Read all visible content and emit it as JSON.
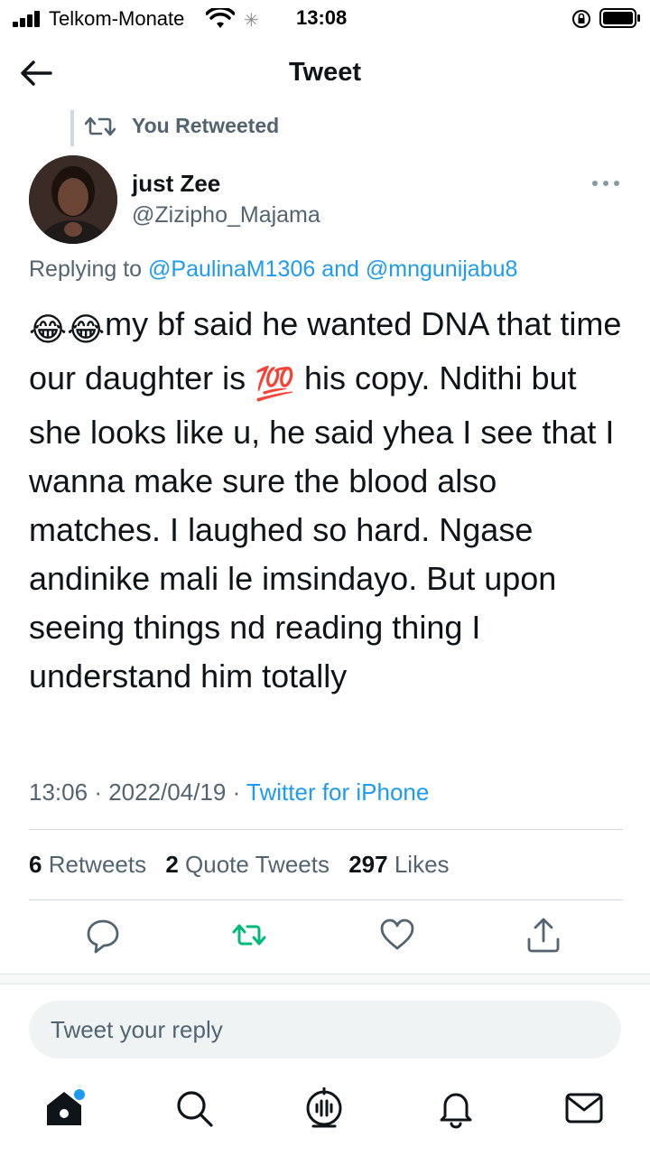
{
  "status_bar": {
    "carrier": "Telkom-Monate",
    "time": "13:08"
  },
  "header": {
    "title": "Tweet"
  },
  "retweet_context": {
    "label": "You Retweeted"
  },
  "author": {
    "name": "just Zee",
    "handle": "@Zizipho_Majama"
  },
  "replying": {
    "prefix": "Replying to",
    "mention_1": "@PaulinaM1306",
    "conjunction": "and",
    "mention_2": "@mngunijabu8"
  },
  "tweet": {
    "emojis_lead": "😂😂",
    "text_part1": "my bf said he wanted DNA that time our daughter is",
    "emoji_mid": "💯",
    "text_part2": "his copy. Ndithi but she looks like u, he said yhea I see that I wanna make sure the blood also matches. I laughed so hard. Ngase andinike mali le imsindayo. But upon seeing things nd reading thing I understand him totally",
    "time": "13:06",
    "date": "2022/04/19",
    "source": "Twitter for iPhone"
  },
  "stats": {
    "retweets_count": "6",
    "retweets_label": "Retweets",
    "quotes_count": "2",
    "quotes_label": "Quote Tweets",
    "likes_count": "297",
    "likes_label": "Likes"
  },
  "reply": {
    "placeholder": "Tweet your reply"
  },
  "colors": {
    "accent": "#1d9bf0",
    "retweet_green": "#00ba7c",
    "secondary_text": "#536471"
  },
  "icons": {
    "actions": [
      "reply-icon",
      "retweet-icon",
      "like-icon",
      "share-icon"
    ],
    "tabs": [
      "home-icon",
      "search-icon",
      "spaces-icon",
      "notifications-icon",
      "messages-icon"
    ]
  }
}
